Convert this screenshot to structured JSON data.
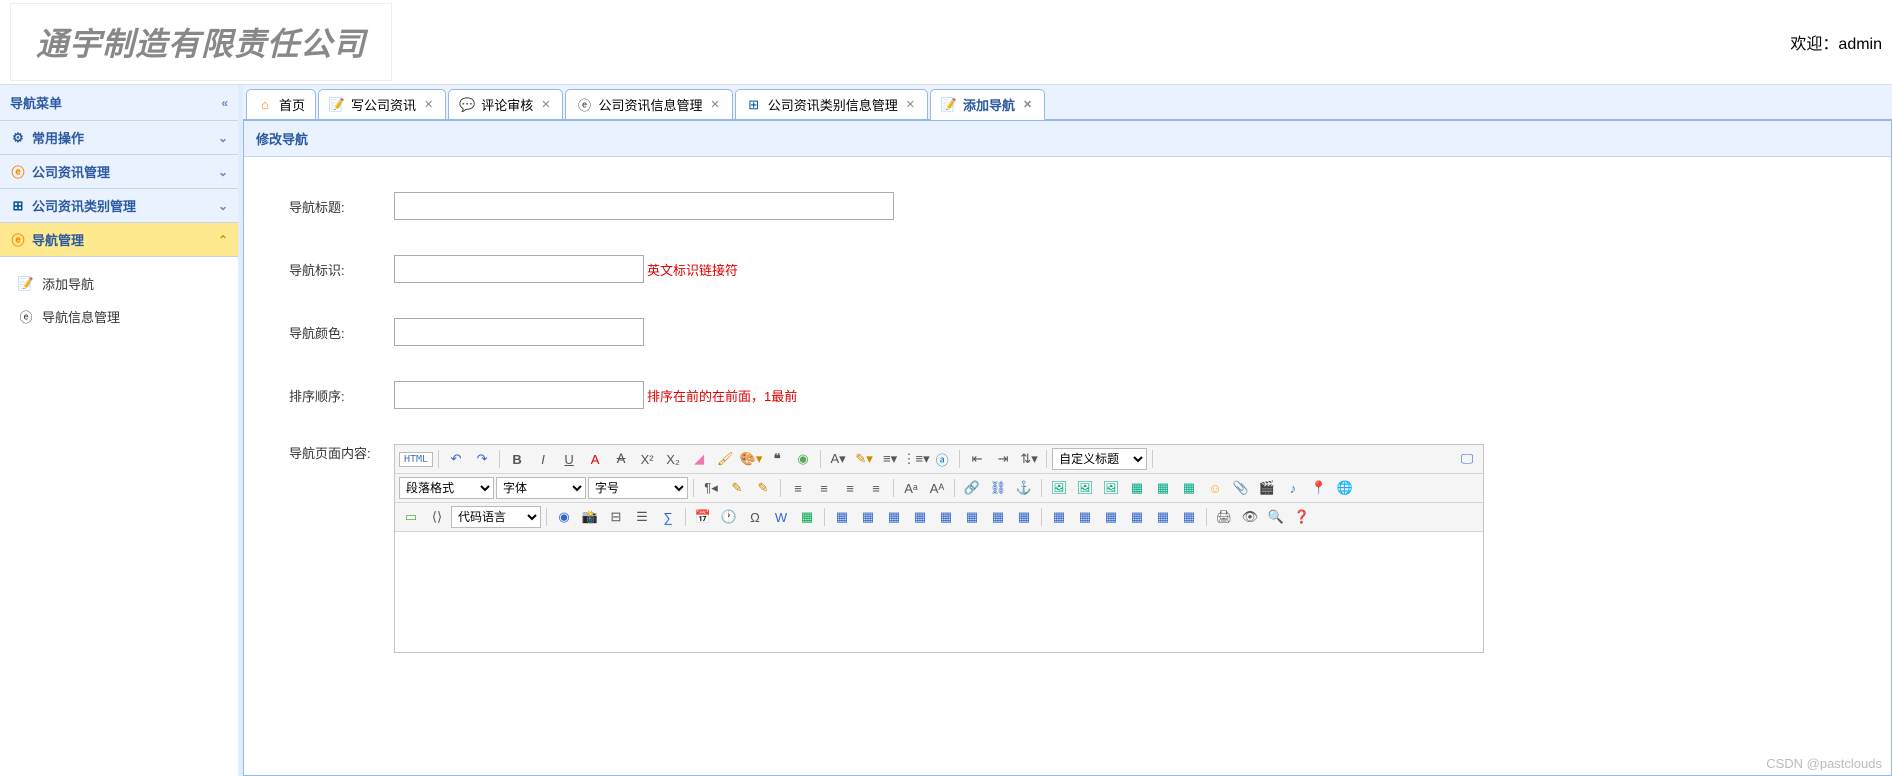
{
  "header": {
    "company_name": "通宇制造有限责任公司",
    "welcome_prefix": "欢迎：",
    "welcome_user": "admin"
  },
  "sidebar": {
    "title": "导航菜单",
    "items": [
      {
        "icon": "gear",
        "label": "常用操作",
        "expanded": false
      },
      {
        "icon": "blog",
        "label": "公司资讯管理",
        "expanded": false
      },
      {
        "icon": "tree",
        "label": "公司资讯类别管理",
        "expanded": false
      },
      {
        "icon": "blog",
        "label": "导航管理",
        "expanded": true
      }
    ],
    "sub_items": [
      {
        "icon": "doc",
        "label": "添加导航"
      },
      {
        "icon": "blog",
        "label": "导航信息管理"
      }
    ]
  },
  "tabs": [
    {
      "icon": "home",
      "label": "首页",
      "closable": false
    },
    {
      "icon": "doc",
      "label": "写公司资讯",
      "closable": true
    },
    {
      "icon": "comment",
      "label": "评论审核",
      "closable": true
    },
    {
      "icon": "blog",
      "label": "公司资讯信息管理",
      "closable": true
    },
    {
      "icon": "tree",
      "label": "公司资讯类别信息管理",
      "closable": true
    },
    {
      "icon": "doc",
      "label": "添加导航",
      "closable": true,
      "active": true
    }
  ],
  "panel": {
    "title": "修改导航",
    "fields": [
      {
        "label": "导航标题:",
        "hint": ""
      },
      {
        "label": "导航标识:",
        "hint": "英文标识链接符"
      },
      {
        "label": "导航颜色:",
        "hint": ""
      },
      {
        "label": "排序顺序:",
        "hint": "排序在前的在前面，1最前"
      },
      {
        "label": "导航页面内容:",
        "hint": ""
      }
    ]
  },
  "editor": {
    "html_label": "HTML",
    "selects": {
      "custom_title": "自定义标题",
      "paragraph": "段落格式",
      "font": "字体",
      "size": "字号",
      "code_lang": "代码语言"
    }
  },
  "watermark": "CSDN @pastclouds"
}
